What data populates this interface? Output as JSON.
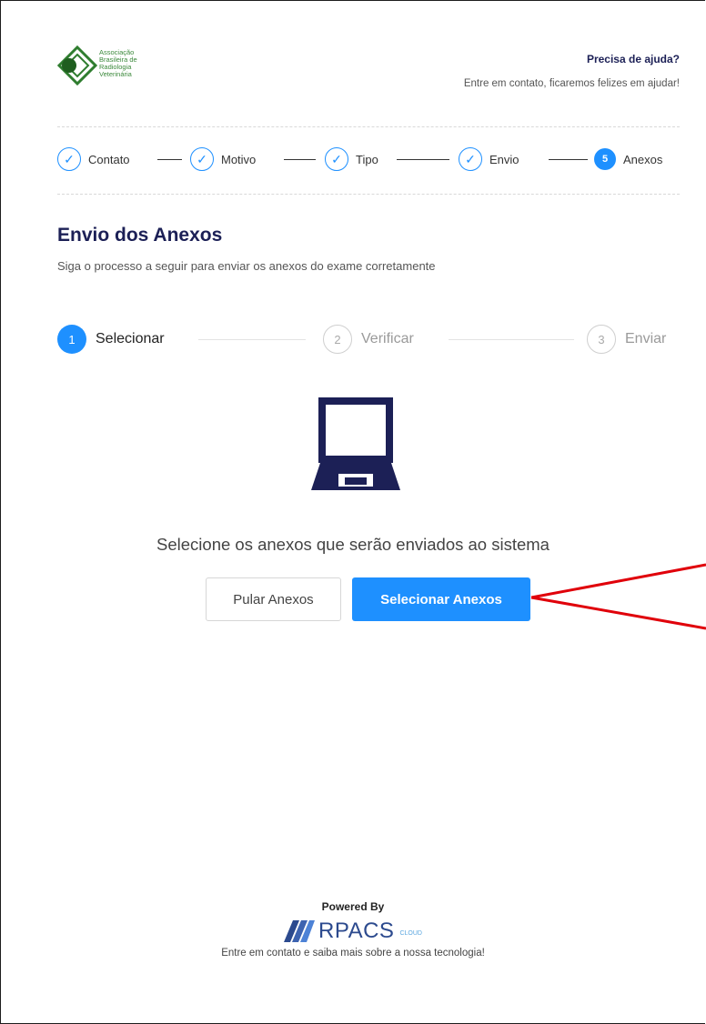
{
  "header": {
    "logo_lines": [
      "Associação",
      "Brasileira de",
      "Radiologia",
      "Veterinária"
    ],
    "help_title": "Precisa de ajuda?",
    "help_subtitle": "Entre em contato, ficaremos felizes em ajudar!"
  },
  "wizard": {
    "steps": [
      {
        "label": "Contato",
        "state": "done"
      },
      {
        "label": "Motivo",
        "state": "done"
      },
      {
        "label": "Tipo",
        "state": "done"
      },
      {
        "label": "Envio",
        "state": "done"
      },
      {
        "label": "Anexos",
        "state": "active",
        "number": "5"
      }
    ],
    "done_glyph": "✓"
  },
  "section": {
    "title": "Envio dos Anexos",
    "subtitle": "Siga o processo a seguir para enviar os anexos do exame corretamente"
  },
  "upload_steps": [
    {
      "number": "1",
      "label": "Selecionar",
      "state": "active"
    },
    {
      "number": "2",
      "label": "Verificar",
      "state": "idle"
    },
    {
      "number": "3",
      "label": "Enviar",
      "state": "idle"
    }
  ],
  "main": {
    "icon": "laptop-icon",
    "prompt": "Selecione os anexos que serão enviados ao sistema",
    "skip_button": "Pular Anexos",
    "select_button": "Selecionar Anexos"
  },
  "footer": {
    "powered_by": "Powered By",
    "brand": "RPACS",
    "brand_tag": "CLOUD",
    "contact": "Entre em contato e saiba mais sobre a nossa tecnologia!"
  },
  "colors": {
    "primary": "#1e90ff",
    "navy": "#1c2056",
    "annotation": "#e0000a",
    "logo_green": "#2f7d2f"
  }
}
